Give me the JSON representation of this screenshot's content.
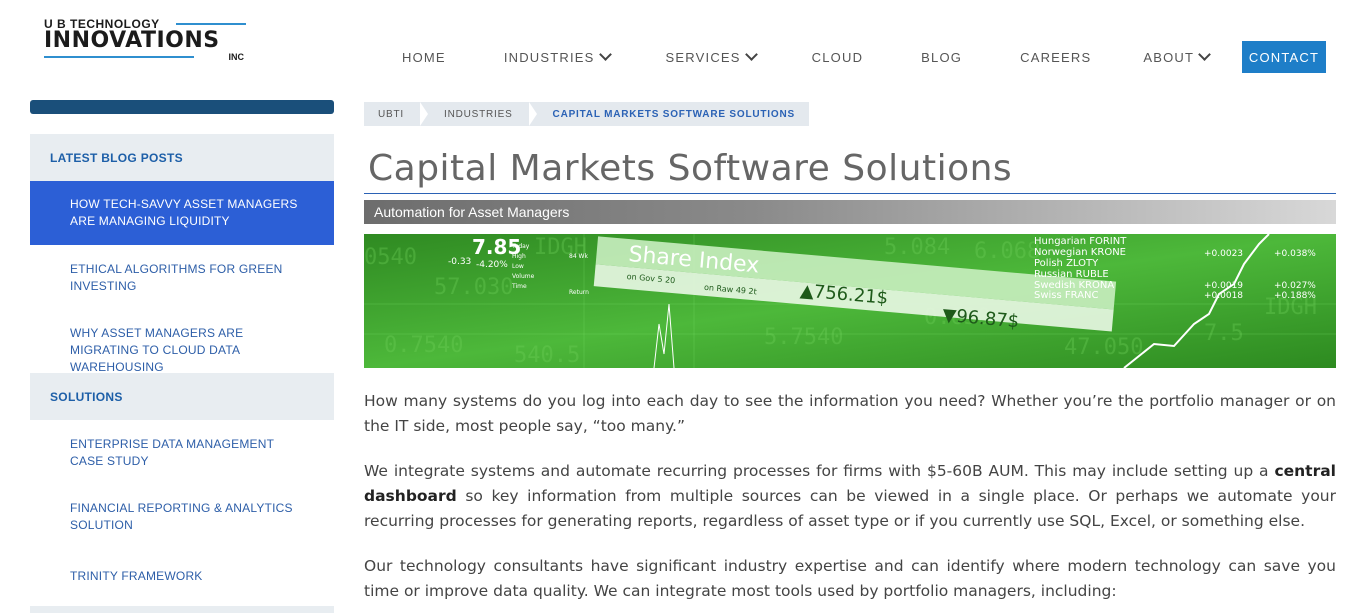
{
  "logo": {
    "top": "U B TECHNOLOGY",
    "main": "INNOVATIONS",
    "inc": "INC"
  },
  "nav": {
    "items": [
      "HOME",
      "INDUSTRIES",
      "SERVICES",
      "CLOUD",
      "BLOG",
      "CAREERS",
      "ABOUT"
    ],
    "contact": "CONTACT"
  },
  "sidebar": {
    "latest_heading": "LATEST BLOG POSTS",
    "posts": [
      "HOW TECH-SAVVY ASSET MANAGERS ARE MANAGING LIQUIDITY",
      "ETHICAL ALGORITHMS FOR GREEN INVESTING",
      "WHY ASSET MANAGERS ARE MIGRATING TO CLOUD DATA WAREHOUSING"
    ],
    "solutions_heading": "SOLUTIONS",
    "solutions": [
      "ENTERPRISE DATA MANAGEMENT CASE STUDY",
      "FINANCIAL REPORTING & ANALYTICS SOLUTION",
      "TRINITY FRAMEWORK"
    ]
  },
  "breadcrumb": [
    "UBTI",
    "INDUSTRIES",
    "CAPITAL MARKETS SOFTWARE SOLUTIONS"
  ],
  "page": {
    "title": "Capital Markets Software Solutions",
    "subtitle": "Automation for Asset Managers"
  },
  "hero": {
    "share_index": "Share Index",
    "val_up": "▲756.21$",
    "val_down": "▼96.87$",
    "big_number": "7.85",
    "currencies": [
      "Hungarian FORINT",
      "Norwegian KRONE",
      "Polish ZLOTY",
      "Russian RUBLE",
      "Swedish KRONA",
      "Swiss FRANC"
    ],
    "changes": [
      "+0.0023",
      "+0.038%",
      "+0.0019",
      "+0.027%",
      "+0.0018",
      "+0.188%"
    ]
  },
  "body": {
    "p1": "How many systems do you log into each day to see the information you need? Whether you’re the portfolio manager or on the IT side, most people say, “too many.”",
    "p2_a": "We integrate systems and automate recurring processes for firms with $5-60B AUM. This may include setting up a ",
    "p2_bold": "central dashboard",
    "p2_b": " so key information from multiple sources can be viewed in a single place. Or perhaps we automate your recurring processes for generating reports, regardless of asset type or if you currently use SQL, Excel, or something else.",
    "p3": "Our technology consultants have significant industry expertise and can identify where modern technology can save you time or improve data quality. We can integrate most tools used by portfolio managers, including:"
  },
  "colors": {
    "accent": "#1e7ec8",
    "sidebar_active": "#2c5fd6",
    "link": "#2d5ea8"
  }
}
